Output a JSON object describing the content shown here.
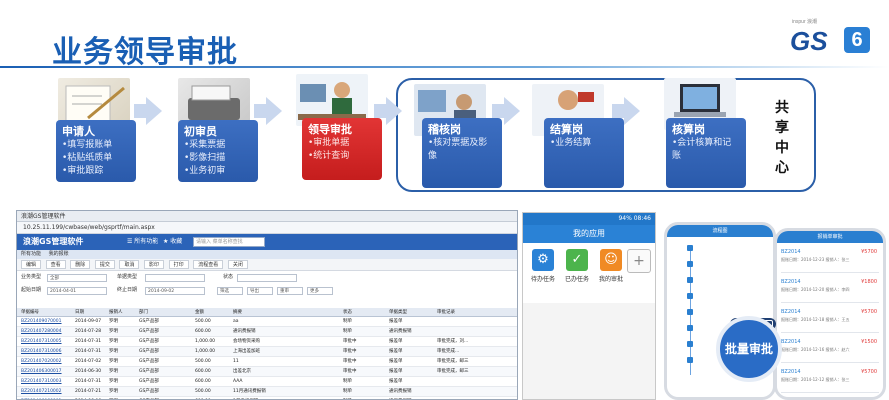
{
  "header": {
    "title": "业务领导审批",
    "logo_small": "inspur 浪潮",
    "logo_text": "GS",
    "logo_num": "6"
  },
  "flow": {
    "shared_center": [
      "共",
      "享",
      "中",
      "心"
    ],
    "steps": [
      {
        "title": "申请人",
        "lines": [
          "•填写报账单",
          "•粘贴纸质单",
          "•审批跟踪"
        ],
        "style": "blue"
      },
      {
        "title": "初审员",
        "lines": [
          "•采集票据",
          "•影像扫描",
          "•业务初审"
        ],
        "style": "blue"
      },
      {
        "title": "领导审批",
        "lines": [
          "•审批单据",
          "•统计查询"
        ],
        "style": "red"
      },
      {
        "title": "稽核岗",
        "lines": [
          "•核对票据及影",
          "像"
        ],
        "style": "blue"
      },
      {
        "title": "结算岗",
        "lines": [
          "•业务结算"
        ],
        "style": "blue"
      },
      {
        "title": "核算岗",
        "lines": [
          "•会计核算和记",
          "账"
        ],
        "style": "blue"
      }
    ]
  },
  "desktop": {
    "window_title": "浪潮GS管理软件",
    "url": "10.25.11.199/cwbase/web/gsprtf/main.aspx",
    "app_name": "浪潮GS管理软件",
    "nav_all": "所有功能",
    "nav_fav": "收藏",
    "search_placeholder": "请输入 菜单名称查找",
    "tabs": [
      "所有功能",
      "我的报账"
    ],
    "toolbar": [
      "编辑",
      "查看",
      "删除",
      "提交",
      "取消",
      "影印",
      "打印",
      "流程查看",
      "关闭"
    ],
    "filter": {
      "row1_label": "业务类型",
      "row1_value": "全部",
      "row1_label2": "单据类型",
      "row1_label3": "状态",
      "row2_label": "起始日期",
      "row2_value": "2014-04-01",
      "row2_label2": "终止日期",
      "row2_value2": "2014-09-02",
      "btn_filter": "筛选",
      "btn_export": "导出",
      "btn_print": "重审",
      "btn_more": "更多"
    },
    "grid_headers": [
      "单据编号",
      "日期",
      "报销人",
      "部门",
      "金额",
      "摘要",
      "状态",
      "单据类型",
      "审批记录"
    ],
    "grid_rows": [
      [
        "BZ201409070001",
        "2014-09-07",
        "罗明",
        "GS产品部",
        "500.00",
        "aa",
        "制单",
        "报差单",
        ""
      ],
      [
        "BZ201407280004",
        "2014-07-28",
        "罗明",
        "GS产品部",
        "600.00",
        "通讯费报销",
        "制单",
        "通讯费报销",
        ""
      ],
      [
        "BZ201407310005",
        "2014-07-31",
        "罗明",
        "GS产品部",
        "1,000.00",
        "会场物资采购",
        "审批中",
        "报差单",
        "审批完成，刘..."
      ],
      [
        "BZ201407310006",
        "2014-07-31",
        "罗明",
        "GS产品部",
        "1,000.00",
        "上海出差加班",
        "审批中",
        "报差单",
        "审批完成..."
      ],
      [
        "BZ201407020002",
        "2014-07-02",
        "罗明",
        "GS产品部",
        "500.00",
        "11",
        "审批中",
        "报差单",
        "审批完成，邮三"
      ],
      [
        "BZ201406300017",
        "2014-06-30",
        "罗明",
        "GS产品部",
        "600.00",
        "出差北京",
        "审批中",
        "报差单",
        "审批完成，邮三"
      ],
      [
        "BZ201407310003",
        "2014-07-31",
        "罗明",
        "GS产品部",
        "600.00",
        "AAA",
        "制单",
        "报差单",
        ""
      ],
      [
        "BZ201407210002",
        "2014-07-21",
        "罗明",
        "GS产品部",
        "500.00",
        "11月通讯费报销",
        "制单",
        "通讯费报销",
        ""
      ],
      [
        "BZ201406060001",
        "2014-06-06",
        "罗明",
        "GS产品部",
        "600.00",
        "1月手机报销",
        "制单",
        "通讯费报销",
        ""
      ]
    ]
  },
  "mobile": {
    "status": "94% 08:46",
    "title": "我的应用",
    "apps": [
      {
        "label": "待办任务",
        "icon": "⚙",
        "color": "#2a82d6"
      },
      {
        "label": "已办任务",
        "icon": "✓",
        "color": "#4cb44c"
      },
      {
        "label": "我的审批",
        "icon": "☺",
        "color": "#f08a24"
      }
    ],
    "add_icon": "+"
  },
  "phones": {
    "left_title": "流程图",
    "right_title": "报销单审批",
    "badge": "批量审批",
    "cards": [
      {
        "t": "BZ2014",
        "v": "¥5700",
        "s": "报账日期：2014-12-23 报销人：张三"
      },
      {
        "t": "BZ2014",
        "v": "¥1800",
        "s": "报账日期：2014-12-20 报销人：李四"
      },
      {
        "t": "BZ2014",
        "v": "¥5700",
        "s": "报账日期：2014-12-18 报销人：王五"
      },
      {
        "t": "BZ2014",
        "v": "¥1500",
        "s": "报账日期：2014-12-16 报销人：赵六"
      },
      {
        "t": "BZ2014",
        "v": "¥5700",
        "s": "报账日期：2014-12-12 报销人：张三"
      }
    ]
  }
}
